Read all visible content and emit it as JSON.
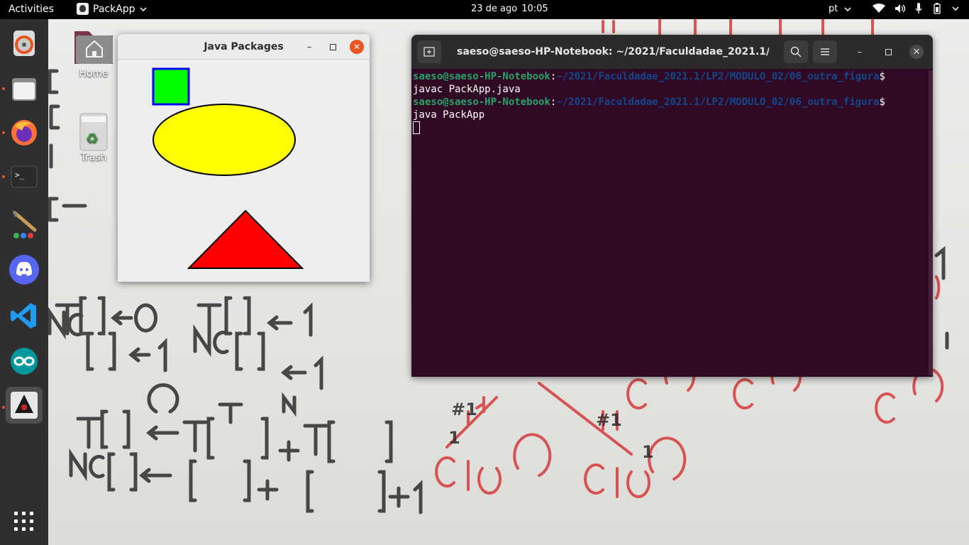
{
  "topbar": {
    "activities": "Activities",
    "app_name": "PackApp",
    "date": "23 de ago",
    "time": "10:05",
    "language": "pt"
  },
  "dock": {
    "items": [
      {
        "name": "ubuntu-software-icon"
      },
      {
        "name": "files-icon"
      },
      {
        "name": "firefox-icon"
      },
      {
        "name": "terminal-icon"
      },
      {
        "name": "paint-icon"
      },
      {
        "name": "discord-icon"
      },
      {
        "name": "vscode-icon"
      },
      {
        "name": "arduino-icon"
      },
      {
        "name": "java-duke-icon"
      },
      {
        "name": "show-apps-icon"
      }
    ]
  },
  "desktop": {
    "home_label": "Home",
    "trash_label": "Trash"
  },
  "java_window": {
    "title": "Java Packages",
    "shapes": [
      {
        "type": "square",
        "fill": "#00ff00",
        "stroke": "#0000ff"
      },
      {
        "type": "ellipse",
        "fill": "#ffff00",
        "stroke": "#000000"
      },
      {
        "type": "triangle",
        "fill": "#ff0000",
        "stroke": "#000000"
      }
    ]
  },
  "terminal": {
    "title": "saeso@saeso-HP-Notebook: ~/2021/Faculdadae_2021.1/LP2/...",
    "user_host": "saeso@saeso-HP-Notebook",
    "path": "~/2021/Faculdadae_2021.1/LP2/MODULO_02/06_outra_figura",
    "prompt_symbol": "$",
    "command1": "javac PackApp.java",
    "command2": "java PackApp"
  },
  "colors": {
    "accent": "#e95420",
    "terminal_bg": "#300a24",
    "prompt_user": "#26a269",
    "prompt_path": "#12488b"
  }
}
